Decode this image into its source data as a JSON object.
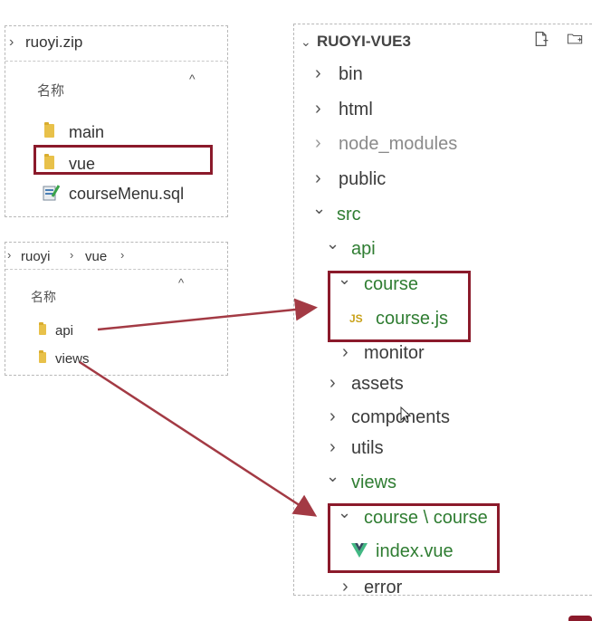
{
  "zip_panel": {
    "breadcrumb": "ruoyi.zip",
    "column_header": "名称",
    "items": [
      {
        "label": "main"
      },
      {
        "label": "vue"
      },
      {
        "label": "courseMenu.sql"
      }
    ]
  },
  "vue_panel": {
    "breadcrumb": [
      "ruoyi",
      "vue"
    ],
    "column_header": "名称",
    "items": [
      {
        "label": "api"
      },
      {
        "label": "views"
      }
    ]
  },
  "explorer": {
    "title": "RUOYI-VUE3",
    "items": {
      "bin": "bin",
      "html": "html",
      "node_modules": "node_modules",
      "public": "public",
      "src": "src",
      "api": "api",
      "course": "course",
      "course_js": "course.js",
      "monitor": "monitor",
      "assets": "assets",
      "components": "components",
      "utils": "utils",
      "views": "views",
      "course_course": "course \\ course",
      "index_vue": "index.vue",
      "error": "error"
    },
    "icons": {
      "js": "JS"
    }
  },
  "colors": {
    "highlight": "#8b1a2b",
    "folder": "#e8c14a",
    "vue_green": "#2f7d32"
  }
}
